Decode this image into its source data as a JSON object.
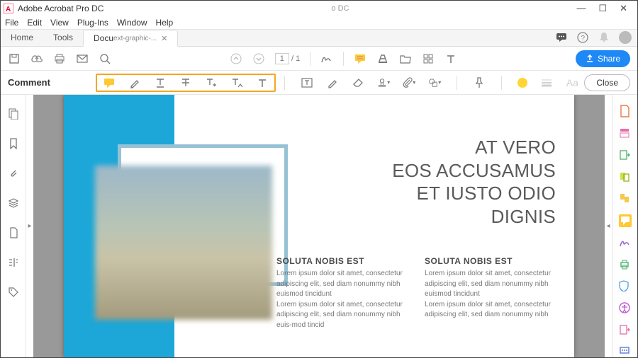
{
  "app": {
    "title": "Adobe Acrobat Pro DC",
    "centerLabel": "o DC"
  },
  "menu": [
    "File",
    "Edit",
    "View",
    "Plug-Ins",
    "Window",
    "Help"
  ],
  "tabs": {
    "home": "Home",
    "tools": "Tools",
    "file": "Docu",
    "fileSuffix": "ext-graphic-..."
  },
  "mainToolbar": {
    "pageCurrent": "1",
    "pageSep": " / ",
    "pageTotal": "1",
    "share": "Share"
  },
  "commentBar": {
    "label": "Comment",
    "close": "Close"
  },
  "document": {
    "headline": "AT VERO\nEOS ACCUSAMUS\nET IUSTO ODIO\nDIGNIS",
    "col1Title": "SOLUTA NOBIS EST",
    "col1Body": "Lorem ipsum dolor sit amet, consectetur adipiscing elit, sed diam nonummy nibh euismod tincidunt\nLorem ipsum dolor sit amet, consectetur adipiscing elit, sed diam nonummy nibh euis-mod tincid",
    "col2Title": "SOLUTA NOBIS EST",
    "col2Body": "Lorem ipsum dolor sit amet, consectetur adipiscing elit, sed diam nonummy nibh euismod tincidunt\nLorem ipsum dolor sit amet, consectetur adipiscing elit, sed diam nonummy nibh"
  },
  "colors": {
    "accentCyan": "#1ca7d8",
    "highlightOrange": "#f5a623",
    "shareBlue": "#1e88f5"
  }
}
